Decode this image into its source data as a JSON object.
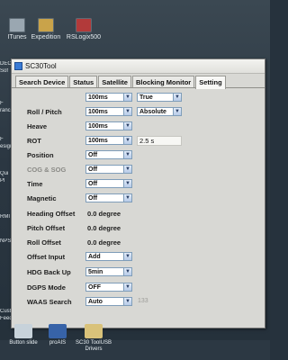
{
  "desktop": {
    "top_icons": [
      {
        "label": "ITunes"
      },
      {
        "label": "Expedition"
      },
      {
        "label": "RSLogix500"
      }
    ],
    "left_strip": [
      "DEC",
      "Sof",
      "F",
      "ranc",
      "F",
      "esigi",
      "Qui",
      "Pl",
      "RMI",
      "NPS W",
      "Cust",
      "Feedt"
    ],
    "bottom_icons": [
      {
        "label": "Button slide"
      },
      {
        "label": "proAIS"
      },
      {
        "label": "SC30 ToolUSB Drivers"
      }
    ]
  },
  "window": {
    "title": "SC30Tool",
    "tabs": [
      "Search Device",
      "Status",
      "Satellite",
      "Blocking Monitor",
      "Setting"
    ],
    "active_tab": "Setting",
    "settings": {
      "top_row": {
        "rate": "100ms",
        "option": "True"
      },
      "roll_pitch": {
        "label": "Roll / Pitch",
        "rate": "100ms",
        "option": "Absolute"
      },
      "heave": {
        "label": "Heave",
        "rate": "100ms"
      },
      "rot": {
        "label": "ROT",
        "rate": "100ms",
        "value": "2.5 s"
      },
      "position": {
        "label": "Position",
        "rate": "Off"
      },
      "cog_sog": {
        "label": "COG & SOG",
        "rate": "Off"
      },
      "time": {
        "label": "Time",
        "rate": "Off"
      },
      "magnetic": {
        "label": "Magnetic",
        "rate": "Off"
      },
      "heading_offset": {
        "label": "Heading Offset",
        "value": "0.0 degree"
      },
      "pitch_offset": {
        "label": "Pitch Offset",
        "value": "0.0 degree"
      },
      "roll_offset": {
        "label": "Roll Offset",
        "value": "0.0 degree"
      },
      "offset_input": {
        "label": "Offset Input",
        "value": "Add"
      },
      "hdg_backup": {
        "label": "HDG Back Up",
        "value": "5min"
      },
      "dgps_mode": {
        "label": "DGPS Mode",
        "value": "OFF"
      },
      "waas_search": {
        "label": "WAAS Search",
        "value": "Auto",
        "hint": "133"
      }
    }
  },
  "colors": {
    "desktop_bg": "#2b3742",
    "window_bg": "#d8d8d4",
    "select_border": "#7f9db9"
  }
}
